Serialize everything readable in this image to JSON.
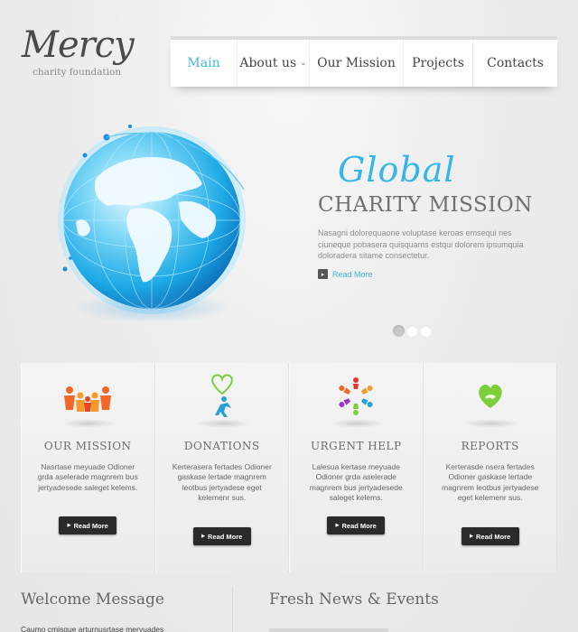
{
  "logo": {
    "name": "Mercy",
    "tagline": "charity foundation"
  },
  "nav": {
    "items": [
      {
        "label": "Main",
        "active": true
      },
      {
        "label": "About us",
        "dropdown": true
      },
      {
        "label": "Our Mission"
      },
      {
        "label": "Projects"
      },
      {
        "label": "Contacts"
      }
    ]
  },
  "hero": {
    "script_title": "Global",
    "title": "CHARITY MISSION",
    "text": "Nasagni dolorequaone voluptase keroas emsequi nes ciuneque pobasera quisquams estqui dolorem ipsumquia doloradera sitame consectetur.",
    "read_more": "Read More",
    "slides": 3,
    "active_slide": 1
  },
  "cards": [
    {
      "icon": "people-icon",
      "title": "OUR MISSION",
      "text": "Nasrtase meyuade Odioner grda aselerade magnrem bus jertyadesede saleget kelems.",
      "button": "Read More"
    },
    {
      "icon": "heart-person-icon",
      "title": "DONATIONS",
      "text": "Kerterasera fertades Odioner gaskase lertade magnrem leotbus jertyadese eget kelemenr sus.",
      "button": "Read More"
    },
    {
      "icon": "community-circle-icon",
      "title": "URGENT HELP",
      "text": "Lalesua kertase meyuade Odioner grda aselerade magnrem bus jertyadesede saleget kelems.",
      "button": "Read More"
    },
    {
      "icon": "heart-hand-icon",
      "title": "REPORTS",
      "text": "Kerterasde nsera fertades Odioner gaskase lertade magnrem leotbus jertyadese eget kelemenr sus.",
      "button": "Read More"
    }
  ],
  "bottom": {
    "welcome_title": "Welcome Message",
    "welcome_text": "Caumo cmisque arturnusrtase meryuades",
    "news_title": "Fresh News & Events"
  },
  "colors": {
    "accent": "#3fb8e6",
    "text": "#555555",
    "button": "#2a2a2a"
  }
}
